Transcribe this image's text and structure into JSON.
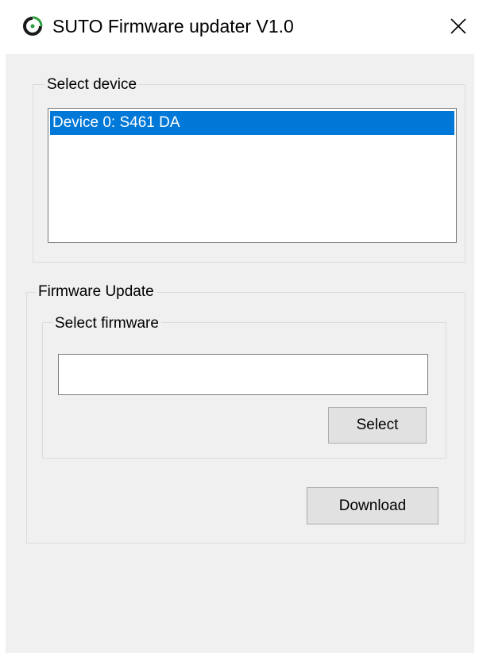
{
  "window": {
    "title": "SUTO Firmware updater V1.0",
    "icon": "circular-power-logo-icon",
    "close_icon": "close-icon",
    "accent_color": "#2e9e3f"
  },
  "device_group": {
    "label": "Select device",
    "devices": [
      {
        "label": "Device 0: S461 DA",
        "selected": true
      }
    ],
    "selection_color": "#0078d7"
  },
  "firmware_group": {
    "label": "Firmware Update",
    "select_firmware": {
      "label": "Select firmware",
      "path_value": "",
      "path_placeholder": "",
      "select_button_label": "Select"
    },
    "download_button_label": "Download"
  }
}
